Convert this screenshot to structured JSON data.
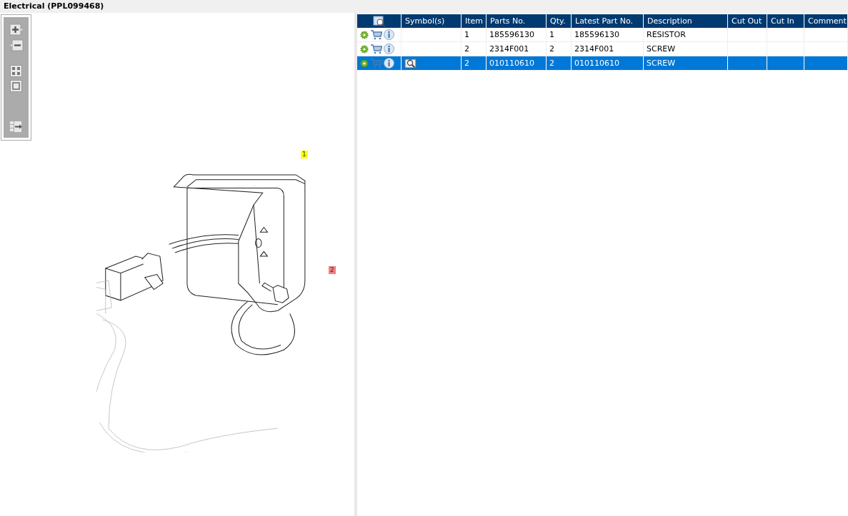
{
  "window": {
    "title": "Electrical (PPL099468)"
  },
  "callouts": [
    {
      "label": "1",
      "color": "#ffff00"
    },
    {
      "label": "2",
      "color": "#f08080"
    }
  ],
  "table": {
    "columns": [
      "",
      "Symbol(s)",
      "Item",
      "Parts No.",
      "Qty.",
      "Latest Part No.",
      "Description",
      "Cut Out",
      "Cut In",
      "Comment"
    ],
    "rows": [
      {
        "selected": false,
        "has_symbol": false,
        "cells": [
          "",
          "",
          "1",
          "185596130",
          "1",
          "185596130",
          "RESISTOR"
        ]
      },
      {
        "selected": false,
        "has_symbol": false,
        "cells": [
          "",
          "",
          "2",
          "2314F001",
          "2",
          "2314F001",
          "SCREW"
        ]
      },
      {
        "selected": true,
        "has_symbol": true,
        "cells": [
          "",
          "",
          "2",
          "010110610",
          "2",
          "010110610",
          "SCREW"
        ]
      }
    ]
  }
}
